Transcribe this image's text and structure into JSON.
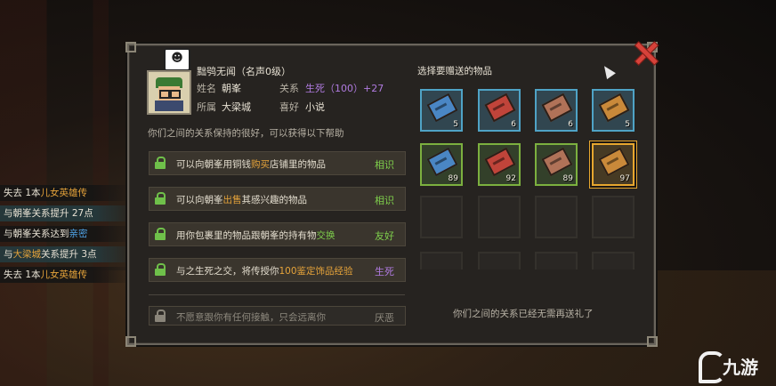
{
  "npc": {
    "name_line": "黜鸮无闻（名声0级）",
    "name_label": "姓名",
    "name": "朝峯",
    "relation_label": "关系",
    "relation_value": "生死（100）+27",
    "faction_label": "所属",
    "faction": "大梁城",
    "hobby_label": "喜好",
    "hobby": "小说",
    "emote": "☻"
  },
  "help_text": "你们之间的关系保持的很好，可以获得以下帮助",
  "options": [
    {
      "pre": "可以向朝峯用铜钱",
      "hl": "购买",
      "post": "店铺里的物品",
      "tier": "相识"
    },
    {
      "pre": "可以向朝峯",
      "hl": "出售",
      "post": "其感兴趣的物品",
      "tier": "相识"
    },
    {
      "pre": "用你包裹里的物品跟朝峯的持有物",
      "hl": "交换",
      "post": "",
      "tier": "友好"
    },
    {
      "pre": "与之生死之交，将传授你",
      "hl": "100鉴定饰品经验",
      "post": "",
      "tier": "生死"
    },
    {
      "pre": "不愿意跟你有任何接触，只会远离你",
      "hl": "",
      "post": "",
      "tier": "厌恶"
    }
  ],
  "gift_title": "选择要赠送的物品",
  "gifts": [
    {
      "qty": "5",
      "frame": "blue",
      "color": "#4a86c4"
    },
    {
      "qty": "6",
      "frame": "blue",
      "color": "#c0443a"
    },
    {
      "qty": "6",
      "frame": "blue",
      "color": "#b07258"
    },
    {
      "qty": "5",
      "frame": "blue",
      "color": "#c9893a"
    },
    {
      "qty": "89",
      "frame": "green",
      "color": "#4a86c4"
    },
    {
      "qty": "92",
      "frame": "green",
      "color": "#c0443a"
    },
    {
      "qty": "89",
      "frame": "green",
      "color": "#b07258"
    },
    {
      "qty": "97",
      "frame": "gold",
      "color": "#c9893a"
    }
  ],
  "no_gift_text": "你们之间的关系已经无需再送礼了",
  "log": [
    {
      "pre": "失去 1本",
      "hl": "儿女英雄传",
      "post": ""
    },
    {
      "pre": "与朝峯关系提升 27点",
      "hl": "",
      "post": ""
    },
    {
      "pre": "与朝峯关系达到",
      "hl": "亲密",
      "post": ""
    },
    {
      "pre": "与",
      "hl": "大梁城",
      "post": "关系提升 3点"
    },
    {
      "pre": "失去 1本",
      "hl": "儿女英雄传",
      "post": ""
    }
  ],
  "watermark": "九游",
  "colors": {
    "accent_close": "#d6423a",
    "relation": "#b07be0",
    "highlight": "#e5a33a",
    "positive": "#7fd04c"
  }
}
